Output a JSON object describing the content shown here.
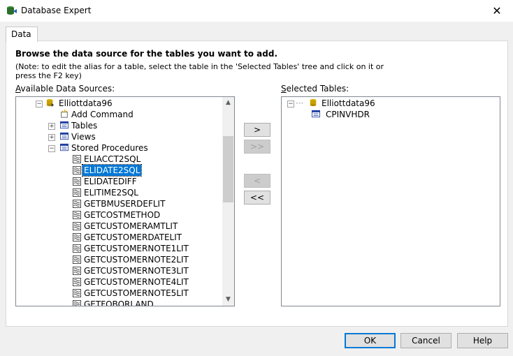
{
  "window": {
    "title": "Database Expert",
    "close_glyph": "✕"
  },
  "tabs": [
    {
      "label": "Data"
    }
  ],
  "instructions": {
    "heading": "Browse the data source for the tables you want to add.",
    "note_line1": "(Note: to edit the alias for a table, select the table in the 'Selected Tables' tree and click on it or",
    "note_line2": "press the F2 key)"
  },
  "available": {
    "label": "Available Data Sources:",
    "tree": [
      {
        "label": "Elliottdata96",
        "icon": "database-icon",
        "expander": "minus"
      },
      {
        "label": "Add Command",
        "icon": "add-command-icon"
      },
      {
        "label": "Tables",
        "icon": "tables-folder-icon",
        "expander": "plus"
      },
      {
        "label": "Views",
        "icon": "views-folder-icon",
        "expander": "plus"
      },
      {
        "label": "Stored Procedures",
        "icon": "procedures-folder-icon",
        "expander": "minus"
      },
      {
        "label": "ELIACCT2SQL",
        "icon": "stored-procedure-icon"
      },
      {
        "label": "ELIDATE2SQL",
        "icon": "stored-procedure-icon",
        "selected": true
      },
      {
        "label": "ELIDATEDIFF",
        "icon": "stored-procedure-icon"
      },
      {
        "label": "ELITIME2SQL",
        "icon": "stored-procedure-icon"
      },
      {
        "label": "GETBMUSERDEFLIT",
        "icon": "stored-procedure-icon"
      },
      {
        "label": "GETCOSTMETHOD",
        "icon": "stored-procedure-icon"
      },
      {
        "label": "GETCUSTOMERAMTLIT",
        "icon": "stored-procedure-icon"
      },
      {
        "label": "GETCUSTOMERDATELIT",
        "icon": "stored-procedure-icon"
      },
      {
        "label": "GETCUSTOMERNOTE1LIT",
        "icon": "stored-procedure-icon"
      },
      {
        "label": "GETCUSTOMERNOTE2LIT",
        "icon": "stored-procedure-icon"
      },
      {
        "label": "GETCUSTOMERNOTE3LIT",
        "icon": "stored-procedure-icon"
      },
      {
        "label": "GETCUSTOMERNOTE4LIT",
        "icon": "stored-procedure-icon"
      },
      {
        "label": "GETCUSTOMERNOTE5LIT",
        "icon": "stored-procedure-icon"
      },
      {
        "label": "GETFOBORLAND",
        "icon": "stored-procedure-icon"
      }
    ]
  },
  "selected": {
    "label": "Selected Tables:",
    "tree": [
      {
        "label": "Elliottdata96",
        "icon": "database-icon",
        "expander": "minus"
      },
      {
        "label": "CPINVHDR",
        "icon": "table-icon"
      }
    ]
  },
  "transfer_buttons": {
    "add": ">",
    "add_all": ">>",
    "remove": "<",
    "remove_all": "<<"
  },
  "footer_buttons": {
    "ok": "OK",
    "cancel": "Cancel",
    "help": "Help"
  },
  "colors": {
    "selection": "#0078d7",
    "default_button_border": "#0078d7"
  }
}
